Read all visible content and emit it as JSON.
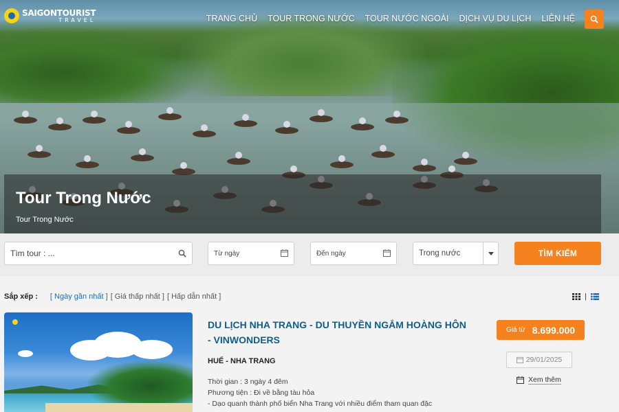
{
  "brand": {
    "name": "SAIGONTOURIST",
    "sub": "TRAVEL"
  },
  "nav": {
    "items": [
      {
        "label": "TRANG CHỦ"
      },
      {
        "label": "TOUR TRONG NƯỚC"
      },
      {
        "label": "TOUR NƯỚC NGOÀI"
      },
      {
        "label": "DỊCH VỤ DU LỊCH"
      },
      {
        "label": "LIÊN HỆ"
      }
    ],
    "search_icon": "search-icon"
  },
  "hero": {
    "title": "Tour Trong Nước",
    "breadcrumb": "Tour Trong Nước"
  },
  "search": {
    "keyword_placeholder": "Tìm tour : ...",
    "from_placeholder": "Từ ngày",
    "to_placeholder": "Đến ngày",
    "type_value": "Trong nước",
    "button": "TÌM KIẾM"
  },
  "sort": {
    "label": "Sắp xếp :",
    "options": [
      "[ Ngày gần nhất ]",
      "[ Giá thấp nhất ]",
      "[ Hấp dẫn nhất ]"
    ],
    "active": 0
  },
  "view": {
    "separator": "|"
  },
  "tours": [
    {
      "title": "DU LỊCH NHA TRANG - DU THUYỀN NGẮM HOÀNG HÔN - VINWONDERS",
      "route": "HUẾ - NHA TRANG",
      "duration": "Thời gian : 3 ngày 4 đêm",
      "transport": "Phương tiện : Đi về bằng tàu hỏa",
      "desc": "- Dạo quanh thành phố biển Nha Trang với nhiều điểm tham quan đặc",
      "price_label": "Giá từ",
      "price": "8.699.000",
      "date": "29/01/2025",
      "more": "Xem thêm"
    }
  ],
  "colors": {
    "accent": "#f5821f",
    "link": "#1d6bb0",
    "title": "#0d5e8f"
  }
}
